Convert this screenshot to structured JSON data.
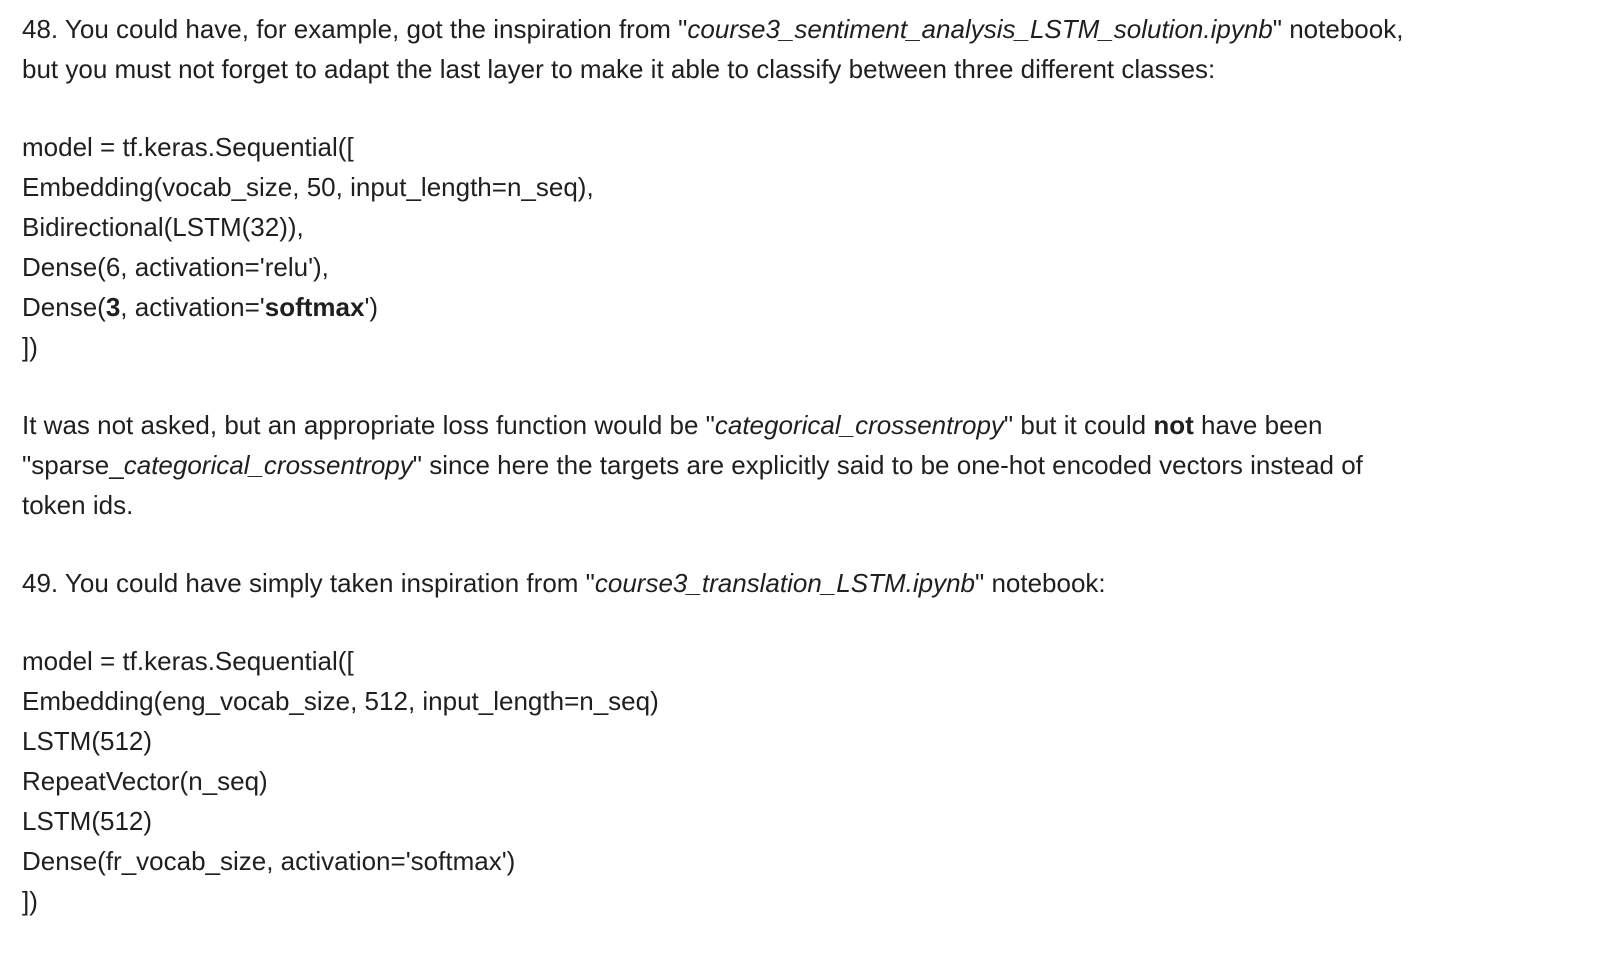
{
  "q48": {
    "line1": {
      "before": "48. You could have, for example, got the inspiration from \"",
      "notebook": "course3_sentiment_analysis_LSTM_solution.ipynb",
      "after": "\" notebook,"
    },
    "line2": "but you must not forget to adapt the last layer to make it able to classify between three different classes:",
    "code": {
      "line1": "model = tf.keras.Sequential([",
      "line2": "Embedding(vocab_size, 50, input_length=n_seq),",
      "line3": "Bidirectional(LSTM(32)),",
      "line4": "Dense(6, activation='relu'),",
      "line5": {
        "a": "Dense(",
        "units": "3",
        "b": ", activation='",
        "activation": "softmax",
        "c": "')"
      },
      "line6": "])"
    },
    "loss_note": {
      "line1": {
        "a": "It was not asked, but an appropriate loss function would be \"",
        "loss": "categorical_crossentropy",
        "b": "\" but it could ",
        "not": "not",
        "c": " have been"
      },
      "line2": {
        "a": "\"sparse_",
        "loss": "categorical_crossentropy",
        "b": "\" since here the targets are explicitly said to be one-hot encoded vectors instead of"
      },
      "line3": "token ids."
    }
  },
  "q49": {
    "line1": {
      "before": "49. You could have simply taken inspiration from \"",
      "notebook": "course3_translation_LSTM.ipynb",
      "after": "\" notebook:"
    },
    "code": {
      "line1": "model = tf.keras.Sequential([",
      "line2": "Embedding(eng_vocab_size, 512, input_length=n_seq)",
      "line3": "LSTM(512)",
      "line4": "RepeatVector(n_seq)",
      "line5": "LSTM(512)",
      "line6": "Dense(fr_vocab_size, activation='softmax')",
      "line7": "])"
    }
  }
}
